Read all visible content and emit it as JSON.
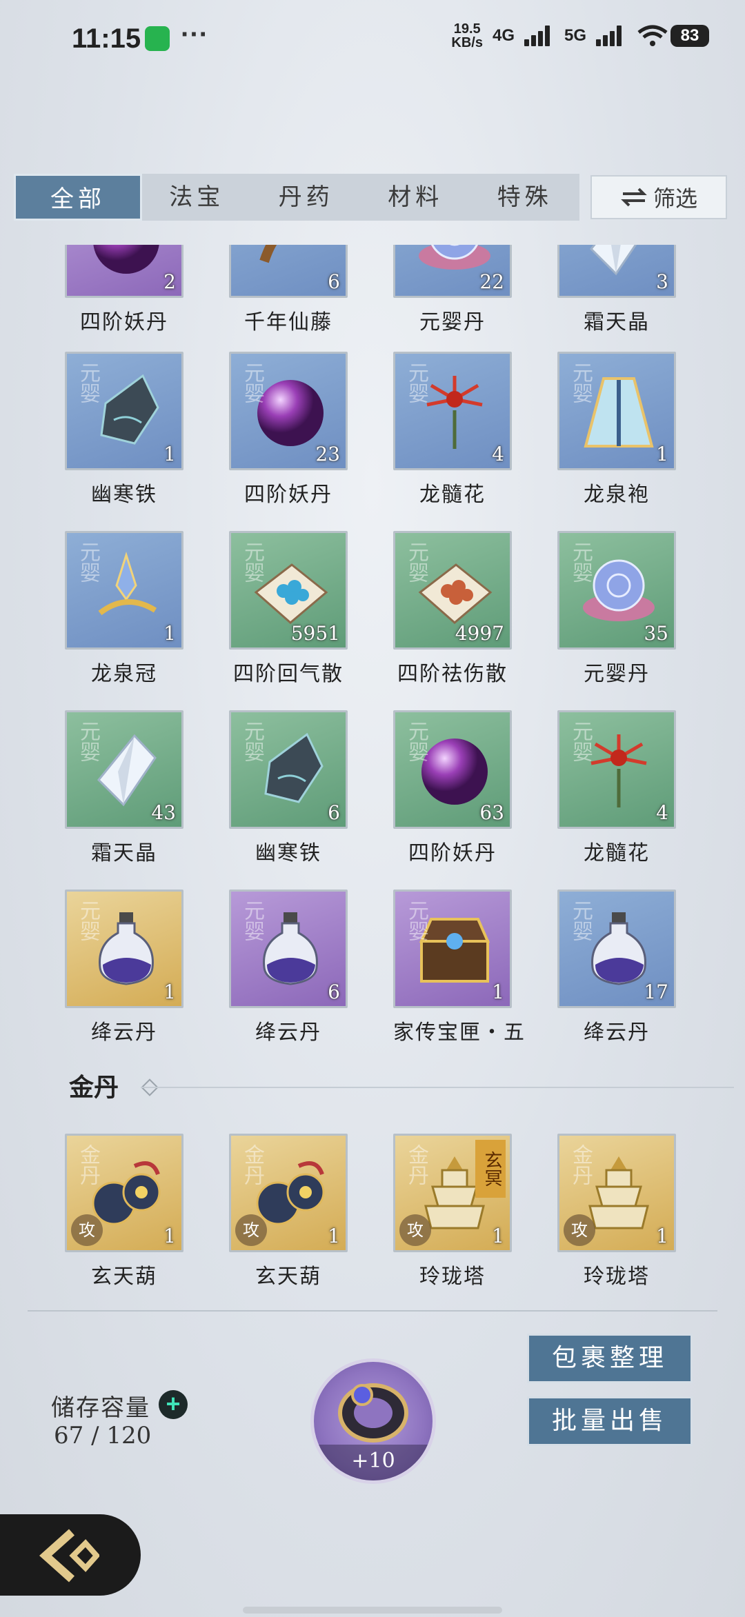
{
  "status_bar": {
    "time": "11:15",
    "dots": "···",
    "speed": "19.5\nKB/s",
    "net1": "4G",
    "net2": "5G",
    "battery": "83"
  },
  "tabs": [
    "全部",
    "法宝",
    "丹药",
    "材料",
    "特殊"
  ],
  "filter_label": "筛选",
  "rows": [
    [
      {
        "name": "四阶妖丹",
        "count": "2",
        "color": "purple",
        "art": "orb"
      },
      {
        "name": "千年仙藤",
        "count": "6",
        "color": "blue",
        "art": "vine"
      },
      {
        "name": "元婴丹",
        "count": "22",
        "color": "blue",
        "art": "pill"
      },
      {
        "name": "霜天晶",
        "count": "3",
        "color": "blue",
        "art": "crystal"
      }
    ],
    [
      {
        "name": "幽寒铁",
        "count": "1",
        "color": "blue",
        "rank": "元婴",
        "art": "ore"
      },
      {
        "name": "四阶妖丹",
        "count": "23",
        "color": "blue",
        "rank": "元婴",
        "art": "orb"
      },
      {
        "name": "龙髓花",
        "count": "4",
        "color": "blue",
        "rank": "元婴",
        "art": "flower"
      },
      {
        "name": "龙泉袍",
        "count": "1",
        "color": "blue",
        "rank": "元婴",
        "art": "robe"
      }
    ],
    [
      {
        "name": "龙泉冠",
        "count": "1",
        "color": "blue",
        "rank": "元婴",
        "art": "crown"
      },
      {
        "name": "四阶回气散",
        "count": "5951",
        "color": "green",
        "rank": "元婴",
        "art": "powder-blue"
      },
      {
        "name": "四阶祛伤散",
        "count": "4997",
        "color": "green",
        "rank": "元婴",
        "art": "powder-red"
      },
      {
        "name": "元婴丹",
        "count": "35",
        "color": "green",
        "rank": "元婴",
        "art": "pill"
      }
    ],
    [
      {
        "name": "霜天晶",
        "count": "43",
        "color": "green",
        "rank": "元婴",
        "art": "crystal"
      },
      {
        "name": "幽寒铁",
        "count": "6",
        "color": "green",
        "rank": "元婴",
        "art": "ore"
      },
      {
        "name": "四阶妖丹",
        "count": "63",
        "color": "green",
        "rank": "元婴",
        "art": "orb"
      },
      {
        "name": "龙髓花",
        "count": "4",
        "color": "green",
        "rank": "元婴",
        "art": "flower"
      }
    ],
    [
      {
        "name": "绛云丹",
        "count": "1",
        "color": "gold",
        "rank": "元婴",
        "art": "bottle"
      },
      {
        "name": "绛云丹",
        "count": "6",
        "color": "purple",
        "rank": "元婴",
        "art": "bottle"
      },
      {
        "name": "家传宝匣・五",
        "count": "1",
        "color": "purple",
        "rank": "元婴",
        "art": "chest"
      },
      {
        "name": "绛云丹",
        "count": "17",
        "color": "blue",
        "rank": "元婴",
        "art": "bottle"
      }
    ]
  ],
  "section_title": "金丹",
  "jindan_rank": "金丹",
  "jindan_items": [
    {
      "name": "玄天葫",
      "count": "1",
      "badge": "攻",
      "art": "gourd"
    },
    {
      "name": "玄天葫",
      "count": "1",
      "badge": "攻",
      "art": "gourd"
    },
    {
      "name": "玲珑塔",
      "count": "1",
      "badge": "攻",
      "tag": "玄冥",
      "art": "tower"
    },
    {
      "name": "玲珑塔",
      "count": "1",
      "badge": "攻",
      "art": "tower"
    }
  ],
  "storage": {
    "label": "储存容量",
    "value": "67 / 120"
  },
  "ring_bonus": "+10",
  "buttons": {
    "organize": "包裹整理",
    "bulk_sell": "批量出售"
  },
  "colors": {
    "tab_active": "#5c7f9d",
    "button": "#4f7594",
    "plus_icon": "#3fe4b9"
  }
}
